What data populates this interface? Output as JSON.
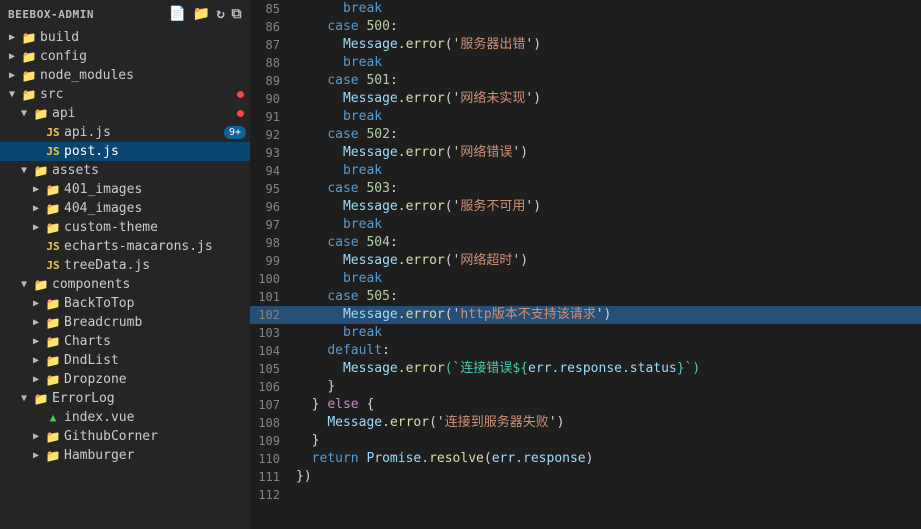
{
  "sidebar": {
    "title": "BEEBOX-ADMIN",
    "icons": [
      "new-file",
      "new-folder",
      "refresh",
      "collapse"
    ],
    "items": [
      {
        "id": "build",
        "label": "build",
        "type": "folder",
        "indent": 0,
        "expanded": false,
        "arrow": "▶"
      },
      {
        "id": "config",
        "label": "config",
        "type": "folder",
        "indent": 0,
        "expanded": false,
        "arrow": "▶"
      },
      {
        "id": "node_modules",
        "label": "node_modules",
        "type": "folder",
        "indent": 0,
        "expanded": false,
        "arrow": "▶"
      },
      {
        "id": "src",
        "label": "src",
        "type": "folder",
        "indent": 0,
        "expanded": true,
        "arrow": "▼",
        "dot": true
      },
      {
        "id": "api",
        "label": "api",
        "type": "folder",
        "indent": 1,
        "expanded": true,
        "arrow": "▼",
        "dot": true
      },
      {
        "id": "api.js",
        "label": "api.js",
        "type": "js",
        "indent": 2,
        "badge": "9+"
      },
      {
        "id": "post.js",
        "label": "post.js",
        "type": "js",
        "indent": 2,
        "active": true
      },
      {
        "id": "assets",
        "label": "assets",
        "type": "folder",
        "indent": 1,
        "expanded": true,
        "arrow": "▼"
      },
      {
        "id": "401_images",
        "label": "401_images",
        "type": "folder",
        "indent": 2,
        "expanded": false,
        "arrow": "▶"
      },
      {
        "id": "404_images",
        "label": "404_images",
        "type": "folder",
        "indent": 2,
        "expanded": false,
        "arrow": "▶"
      },
      {
        "id": "custom-theme",
        "label": "custom-theme",
        "type": "folder",
        "indent": 2,
        "expanded": false,
        "arrow": "▶"
      },
      {
        "id": "echarts-macarons.js",
        "label": "echarts-macarons.js",
        "type": "js",
        "indent": 2
      },
      {
        "id": "treeData.js",
        "label": "treeData.js",
        "type": "js",
        "indent": 2
      },
      {
        "id": "components",
        "label": "components",
        "type": "folder",
        "indent": 1,
        "expanded": true,
        "arrow": "▼"
      },
      {
        "id": "BackToTop",
        "label": "BackToTop",
        "type": "folder",
        "indent": 2,
        "expanded": false,
        "arrow": "▶"
      },
      {
        "id": "Breadcrumb",
        "label": "Breadcrumb",
        "type": "folder",
        "indent": 2,
        "expanded": false,
        "arrow": "▶"
      },
      {
        "id": "Charts",
        "label": "Charts",
        "type": "folder",
        "indent": 2,
        "expanded": false,
        "arrow": "▶"
      },
      {
        "id": "DndList",
        "label": "DndList",
        "type": "folder",
        "indent": 2,
        "expanded": false,
        "arrow": "▶"
      },
      {
        "id": "Dropzone",
        "label": "Dropzone",
        "type": "folder",
        "indent": 2,
        "expanded": false,
        "arrow": "▶"
      },
      {
        "id": "ErrorLog",
        "label": "ErrorLog",
        "type": "folder",
        "indent": 1,
        "expanded": true,
        "arrow": "▼"
      },
      {
        "id": "index.vue",
        "label": "index.vue",
        "type": "vue",
        "indent": 2
      },
      {
        "id": "GithubCorner",
        "label": "GithubCorner",
        "type": "folder",
        "indent": 2,
        "expanded": false,
        "arrow": "▶"
      },
      {
        "id": "Hamburger",
        "label": "Hamburger",
        "type": "folder",
        "indent": 2,
        "expanded": false,
        "arrow": "▶"
      }
    ]
  },
  "code": {
    "lines": [
      {
        "num": 85,
        "tokens": [
          {
            "text": "      break",
            "class": "kw"
          }
        ]
      },
      {
        "num": 86,
        "tokens": [
          {
            "text": "    ",
            "class": ""
          },
          {
            "text": "case",
            "class": "kw"
          },
          {
            "text": " ",
            "class": ""
          },
          {
            "text": "500",
            "class": "num"
          },
          {
            "text": ":",
            "class": "op"
          }
        ]
      },
      {
        "num": 87,
        "tokens": [
          {
            "text": "      ",
            "class": ""
          },
          {
            "text": "Message",
            "class": "prop"
          },
          {
            "text": ".",
            "class": "op"
          },
          {
            "text": "error",
            "class": "fn"
          },
          {
            "text": "('",
            "class": "op"
          },
          {
            "text": "服务器出错",
            "class": "str"
          },
          {
            "text": "')",
            "class": "op"
          }
        ]
      },
      {
        "num": 88,
        "tokens": [
          {
            "text": "      ",
            "class": ""
          },
          {
            "text": "break",
            "class": "kw"
          }
        ]
      },
      {
        "num": 89,
        "tokens": [
          {
            "text": "    ",
            "class": ""
          },
          {
            "text": "case",
            "class": "kw"
          },
          {
            "text": " ",
            "class": ""
          },
          {
            "text": "501",
            "class": "num"
          },
          {
            "text": ":",
            "class": "op"
          }
        ]
      },
      {
        "num": 90,
        "tokens": [
          {
            "text": "      ",
            "class": ""
          },
          {
            "text": "Message",
            "class": "prop"
          },
          {
            "text": ".",
            "class": "op"
          },
          {
            "text": "error",
            "class": "fn"
          },
          {
            "text": "('",
            "class": "op"
          },
          {
            "text": "网络未实现",
            "class": "str"
          },
          {
            "text": "')",
            "class": "op"
          }
        ]
      },
      {
        "num": 91,
        "tokens": [
          {
            "text": "      ",
            "class": ""
          },
          {
            "text": "break",
            "class": "kw"
          }
        ]
      },
      {
        "num": 92,
        "tokens": [
          {
            "text": "    ",
            "class": ""
          },
          {
            "text": "case",
            "class": "kw"
          },
          {
            "text": " ",
            "class": ""
          },
          {
            "text": "502",
            "class": "num"
          },
          {
            "text": ":",
            "class": "op"
          }
        ]
      },
      {
        "num": 93,
        "tokens": [
          {
            "text": "      ",
            "class": ""
          },
          {
            "text": "Message",
            "class": "prop"
          },
          {
            "text": ".",
            "class": "op"
          },
          {
            "text": "error",
            "class": "fn"
          },
          {
            "text": "('",
            "class": "op"
          },
          {
            "text": "网络错误",
            "class": "str"
          },
          {
            "text": "')",
            "class": "op"
          }
        ]
      },
      {
        "num": 94,
        "tokens": [
          {
            "text": "      ",
            "class": ""
          },
          {
            "text": "break",
            "class": "kw"
          }
        ]
      },
      {
        "num": 95,
        "tokens": [
          {
            "text": "    ",
            "class": ""
          },
          {
            "text": "case",
            "class": "kw"
          },
          {
            "text": " ",
            "class": ""
          },
          {
            "text": "503",
            "class": "num"
          },
          {
            "text": ":",
            "class": "op"
          }
        ]
      },
      {
        "num": 96,
        "tokens": [
          {
            "text": "      ",
            "class": ""
          },
          {
            "text": "Message",
            "class": "prop"
          },
          {
            "text": ".",
            "class": "op"
          },
          {
            "text": "error",
            "class": "fn"
          },
          {
            "text": "('",
            "class": "op"
          },
          {
            "text": "服务不可用",
            "class": "str"
          },
          {
            "text": "')",
            "class": "op"
          }
        ]
      },
      {
        "num": 97,
        "tokens": [
          {
            "text": "      ",
            "class": ""
          },
          {
            "text": "break",
            "class": "kw"
          }
        ]
      },
      {
        "num": 98,
        "tokens": [
          {
            "text": "    ",
            "class": ""
          },
          {
            "text": "case",
            "class": "kw"
          },
          {
            "text": " ",
            "class": ""
          },
          {
            "text": "504",
            "class": "num"
          },
          {
            "text": ":",
            "class": "op"
          }
        ]
      },
      {
        "num": 99,
        "tokens": [
          {
            "text": "      ",
            "class": ""
          },
          {
            "text": "Message",
            "class": "prop"
          },
          {
            "text": ".",
            "class": "op"
          },
          {
            "text": "error",
            "class": "fn"
          },
          {
            "text": "('",
            "class": "op"
          },
          {
            "text": "网络超时",
            "class": "str"
          },
          {
            "text": "')",
            "class": "op"
          }
        ]
      },
      {
        "num": 100,
        "tokens": [
          {
            "text": "      ",
            "class": ""
          },
          {
            "text": "break",
            "class": "kw"
          }
        ]
      },
      {
        "num": 101,
        "tokens": [
          {
            "text": "    ",
            "class": ""
          },
          {
            "text": "case",
            "class": "kw"
          },
          {
            "text": " ",
            "class": ""
          },
          {
            "text": "505",
            "class": "num"
          },
          {
            "text": ":",
            "class": "op"
          }
        ]
      },
      {
        "num": 102,
        "tokens": [
          {
            "text": "      ",
            "class": ""
          },
          {
            "text": "Message",
            "class": "prop"
          },
          {
            "text": ".",
            "class": "op"
          },
          {
            "text": "error",
            "class": "fn"
          },
          {
            "text": "('",
            "class": "op"
          },
          {
            "text": "http版本不支持该请求",
            "class": "str"
          },
          {
            "text": "')",
            "class": "op"
          }
        ],
        "highlighted": true
      },
      {
        "num": 103,
        "tokens": [
          {
            "text": "      ",
            "class": ""
          },
          {
            "text": "break",
            "class": "kw"
          }
        ]
      },
      {
        "num": 104,
        "tokens": [
          {
            "text": "    ",
            "class": ""
          },
          {
            "text": "default",
            "class": "kw"
          },
          {
            "text": ":",
            "class": "op"
          }
        ]
      },
      {
        "num": 105,
        "tokens": [
          {
            "text": "      ",
            "class": ""
          },
          {
            "text": "Message",
            "class": "prop"
          },
          {
            "text": ".",
            "class": "op"
          },
          {
            "text": "error",
            "class": "fn"
          },
          {
            "text": "(`连接错误${",
            "class": "str2"
          },
          {
            "text": "err.response.status",
            "class": "prop"
          },
          {
            "text": "}`)",
            "class": "str2"
          }
        ]
      },
      {
        "num": 106,
        "tokens": [
          {
            "text": "    ",
            "class": ""
          },
          {
            "text": "}",
            "class": "op"
          }
        ]
      },
      {
        "num": 107,
        "tokens": [
          {
            "text": "  ",
            "class": ""
          },
          {
            "text": "} ",
            "class": "op"
          },
          {
            "text": "else",
            "class": "kw2"
          },
          {
            "text": " {",
            "class": "op"
          }
        ]
      },
      {
        "num": 108,
        "tokens": [
          {
            "text": "    ",
            "class": ""
          },
          {
            "text": "Message",
            "class": "prop"
          },
          {
            "text": ".",
            "class": "op"
          },
          {
            "text": "error",
            "class": "fn"
          },
          {
            "text": "('",
            "class": "op"
          },
          {
            "text": "连接到服务器失败",
            "class": "str"
          },
          {
            "text": "')",
            "class": "op"
          }
        ]
      },
      {
        "num": 109,
        "tokens": [
          {
            "text": "  ",
            "class": ""
          },
          {
            "text": "}",
            "class": "op"
          }
        ]
      },
      {
        "num": 110,
        "tokens": [
          {
            "text": "  ",
            "class": ""
          },
          {
            "text": "return",
            "class": "kw"
          },
          {
            "text": " ",
            "class": ""
          },
          {
            "text": "Promise",
            "class": "prop"
          },
          {
            "text": ".",
            "class": "op"
          },
          {
            "text": "resolve",
            "class": "fn"
          },
          {
            "text": "(",
            "class": "op"
          },
          {
            "text": "err.response",
            "class": "prop"
          },
          {
            "text": ")",
            "class": "op"
          }
        ]
      },
      {
        "num": 111,
        "tokens": [
          {
            "text": "})",
            "class": "op"
          }
        ]
      },
      {
        "num": 112,
        "tokens": []
      }
    ]
  }
}
